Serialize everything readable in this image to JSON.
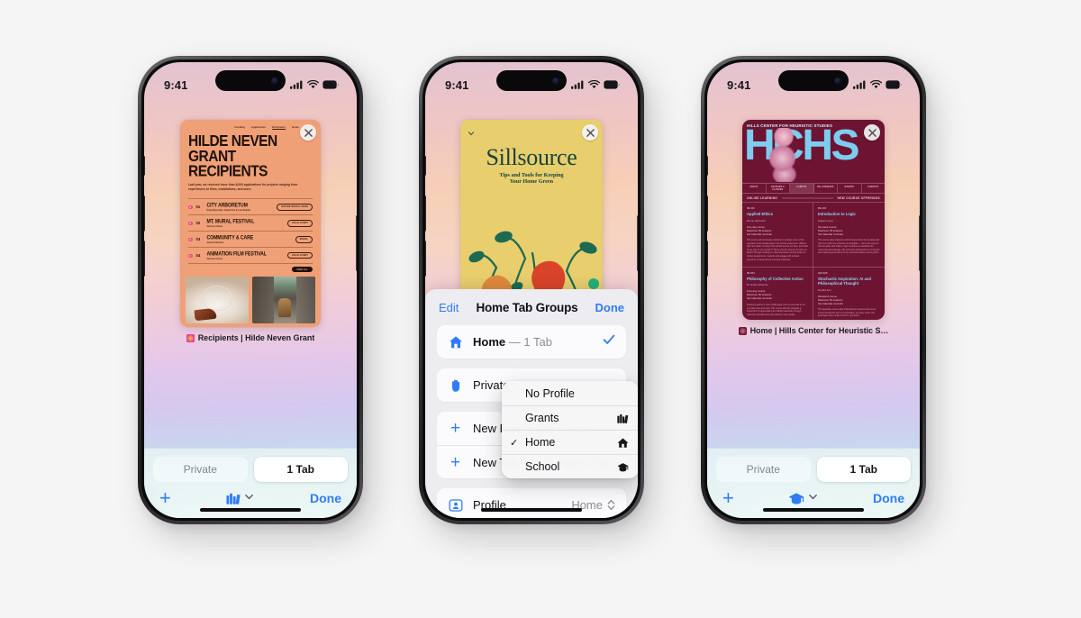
{
  "background": "#f5f5f5",
  "accent": "#2f7cf6",
  "phones": [
    {
      "id": "phone-left",
      "status": {
        "time": "9:41",
        "cellular": "signal-bars",
        "wifi": "wifi-icon",
        "battery": "battery-icon"
      },
      "tab": {
        "label": "Recipients | Hilde Neven Grant",
        "favicon_color": "#f0469b",
        "close": "close-icon"
      },
      "site": {
        "kind": "hilde",
        "nav": [
          "Funding",
          "Application",
          "Recipients",
          "Home"
        ],
        "title_line1": "HILDE NEVEN",
        "title_line2": "GRANT RECIPIENTS",
        "body": "Last year, we received more than 8,000 applications for projects ranging from experiences to films, installations, and more.",
        "rows": [
          {
            "num": "01",
            "name": "CITY ARBORETUM",
            "sub": "Kiiya Reynolds, Isabel Frei & Lou Belette",
            "pill": "NATURE INSTALLATION"
          },
          {
            "num": "02",
            "name": "MT. MURAL FESTIVAL",
            "sub": "Various Artists",
            "pill": "LOCAL EVENT"
          },
          {
            "num": "03",
            "name": "COMMUNITY & CARE",
            "sub": "Joanna Damaro",
            "pill": "MURAL"
          },
          {
            "num": "04",
            "name": "ANIMATION FILM FESTIVAL",
            "sub": "Various Artists",
            "pill": "LOCAL EVENT"
          }
        ],
        "view_all": "VIEW ALL"
      },
      "toolbar": {
        "private_label": "Private",
        "tabs_label": "1 Tab",
        "add": "plus-icon",
        "group_icon": "books-icon",
        "chevron": "chevron-down-icon",
        "done": "Done"
      }
    },
    {
      "id": "phone-center",
      "status": {
        "time": "9:41",
        "cellular": "signal-bars",
        "wifi": "wifi-icon",
        "battery": "battery-icon"
      },
      "tab": {
        "close": "close-icon"
      },
      "site": {
        "kind": "sillsource",
        "title": "Sillsource",
        "subtitle_line1": "Tips and Tools for Keeping",
        "subtitle_line2": "Your Home Green"
      },
      "sheet": {
        "edit": "Edit",
        "title": "Home Tab Groups",
        "done": "Done",
        "groups": [
          {
            "icon": "house-icon",
            "label": "Home",
            "detail": "— 1 Tab",
            "selected": true,
            "check": "checkmark-icon"
          }
        ],
        "actions": [
          {
            "icon": "hand-raised-icon",
            "label": "Private"
          },
          {
            "icon": "plus-icon",
            "label": "New Empty Tab Group"
          },
          {
            "icon": "plus-icon",
            "label": "New Tab Group from 1 Tab"
          }
        ],
        "profile_row": {
          "icon": "person-card-icon",
          "label": "Profile",
          "value": "Home",
          "stepper": "up-down-chevron-icon"
        }
      },
      "popup": {
        "items": [
          {
            "label": "No Profile",
            "checked": false,
            "icon": ""
          },
          {
            "label": "Grants",
            "checked": false,
            "icon": "books-icon"
          },
          {
            "label": "Home",
            "checked": true,
            "icon": "house-icon"
          },
          {
            "label": "School",
            "checked": false,
            "icon": "graduation-cap-icon"
          }
        ]
      }
    },
    {
      "id": "phone-right",
      "status": {
        "time": "9:41",
        "cellular": "signal-bars",
        "wifi": "wifi-icon",
        "battery": "battery-icon"
      },
      "tab": {
        "label": "Home | Hills Center for Heuristic S…",
        "favicon_color": "#6d1432",
        "close": "close-icon"
      },
      "site": {
        "kind": "hchs",
        "topbar": "HILLS CENTER FOR HEURISTIC STUDIES",
        "logo": "HCHS",
        "nav": [
          "ABOUT",
          "COURSES & CLASSES",
          "CAMPUS",
          "FELLOWSHIPS",
          "EVENTS",
          "CONTACT"
        ],
        "section_left": "ONLINE LEARNING",
        "section_right": "NEW COURSE OFFERINGS",
        "courses": [
          {
            "code": "IN-311",
            "name": "Applied Ethics",
            "instructor": "Exene Herbrecht",
            "meta": "Five-day course\nMaximum 50 students\nSet Calendar reminder",
            "desc": "This course will encourage students to consider some of the questions most fundamental to the human experience. What is right and what is wrong? How should we live our lives, and what do we owe to one another? These should I assume by done on Earth? Through readings in class discussion and the ethics of written assignments, students will engage with a broad spectrum of views around concrete examples."
          },
          {
            "code": "IN-146",
            "name": "Introduction to Logic",
            "instructor": "Eugene Lang",
            "meta": "Six-week course\nMaximum 35 students\nSet Calendar reminder",
            "desc": "This course asks students to think deeply about the fundamental norms on which we structure our thoughts — this is the study of how we place and shape. Logic comprises a standard and conventional knowledge. We will study classical forms of thought and reasoning and attend to the essential relations among them."
          },
          {
            "code": "IN-201",
            "name": "Philosophy of Collective Action",
            "instructor": "Dr. Emily Pedersen",
            "meta": "Four-day course\nMaximum 50 students\nSet Calendar reminder",
            "desc": "Seeking together is often challenging, but it is essential to our everyday lives and work. This course will offer students a framework for appreciating the affinity leadership through collective and discursive groundwork, case studies."
          },
          {
            "code": "GR-222",
            "name": "Stochastic Inspiration: AI and Philosophical Thought",
            "instructor": "Monika Kim",
            "meta": "Weekend course\nMaximum 50 students\nSet Calendar reminder",
            "desc": "This graduate course asks philosophical inquiries and recent trends through the lens of computation, as many of the new techniques were rediscovered in new fields."
          }
        ]
      },
      "toolbar": {
        "private_label": "Private",
        "tabs_label": "1 Tab",
        "add": "plus-icon",
        "group_icon": "graduation-cap-icon",
        "chevron": "chevron-down-icon",
        "done": "Done"
      }
    }
  ]
}
